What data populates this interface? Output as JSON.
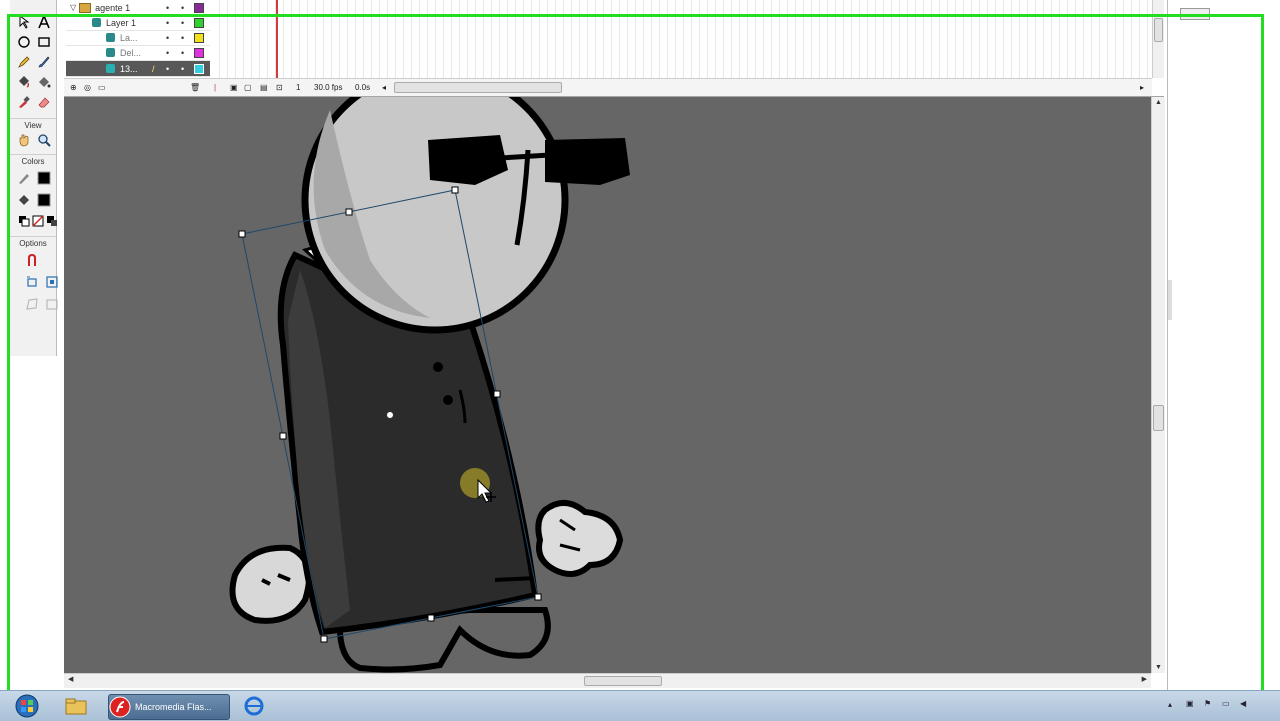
{
  "timeline": {
    "layers": [
      {
        "name": "agente 1",
        "type": "folder"
      },
      {
        "name": "Layer 1",
        "type": "layer"
      },
      {
        "name": "La...",
        "type": "layer"
      },
      {
        "name": "Del...",
        "type": "layer"
      },
      {
        "name": "13...",
        "type": "layer",
        "selected": true
      }
    ],
    "frame_number": "1",
    "fps": "30.0 fps",
    "time": "0.0s"
  },
  "tools": {
    "view_label": "View",
    "colors_label": "Colors",
    "options_label": "Options"
  },
  "taskbar": {
    "flash_label": "Macromedia Flas..."
  },
  "colors": {
    "stage": "#666666",
    "frame_highlight": "#22dd22",
    "selection": "#2c4f6e"
  }
}
